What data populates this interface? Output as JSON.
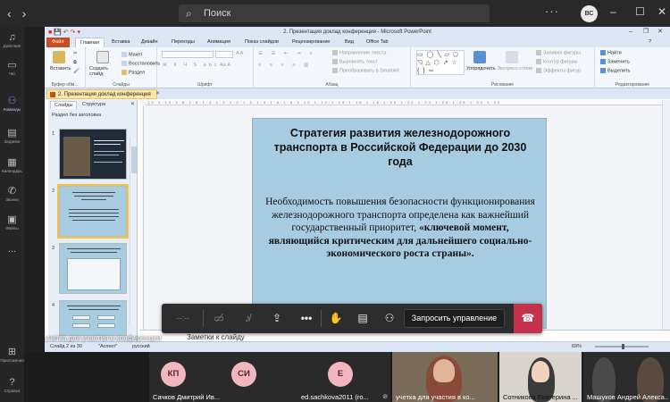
{
  "teams": {
    "search_placeholder": "Поиск",
    "user_initials": "ВС",
    "more_label": "···",
    "window_controls": [
      "–",
      "☐",
      "✕"
    ],
    "rail": [
      {
        "label": "Действия",
        "icon": "bell-icon"
      },
      {
        "label": "Чат",
        "icon": "chat-icon"
      },
      {
        "label": "Команды",
        "icon": "teams-icon",
        "active": true
      },
      {
        "label": "Задания",
        "icon": "assignments-icon"
      },
      {
        "label": "Календарь",
        "icon": "calendar-icon"
      },
      {
        "label": "Звонки",
        "icon": "phone-icon"
      },
      {
        "label": "Файлы",
        "icon": "files-icon"
      },
      {
        "label": "...",
        "icon": "more-icon"
      },
      {
        "label": "Приложения",
        "icon": "apps-icon"
      },
      {
        "label": "Справка",
        "icon": "help-icon"
      }
    ]
  },
  "ppt": {
    "window_title": "2. Презентация доклад конференция - Microsoft PowerPoint",
    "tabs": [
      "Файл",
      "Главная",
      "Вставка",
      "Дизайн",
      "Переходы",
      "Анимация",
      "Показ слайдов",
      "Рецензирование",
      "Вид",
      "Office Tab"
    ],
    "ribbon": {
      "paste": "Вставить",
      "clipboard_group": "Буфер обм...",
      "new_slide": "Создать слайд",
      "layout": "Макет",
      "reset": "Восстановить",
      "section": "Раздел",
      "slides_group": "Слайды",
      "font_group": "Шрифт",
      "paragraph_group": "Абзац",
      "text_direction": "Направление текста",
      "align_text": "Выровнять текст",
      "smartart": "Преобразовать в SmartArt",
      "arrange": "Упорядочить",
      "quick_styles": "Экспресс-стили",
      "shape_fill": "Заливка фигуры",
      "shape_outline": "Контур фигуры",
      "shape_effects": "Эффекты фигур",
      "drawing_group": "Рисование",
      "find": "Найти",
      "replace": "Заменить",
      "select": "Выделить",
      "editing_group": "Редактирование"
    },
    "doc_tab": "2. Презентация доклад конференция",
    "left_tabs": [
      "Слайды",
      "Структура"
    ],
    "section_label": "Раздел без заголовка",
    "thumb_numbers": [
      "1",
      "2",
      "3",
      "4"
    ],
    "slide": {
      "title": "Стратегия развития железнодорожного транспорта в Российской Федерации до 2030 года",
      "body_plain": "Необходимость повышения безопасности функционирования железнодорожного транспорта определена как важнейший государственный приоритет, ",
      "body_bold": "«ключевой момент, являющийся критическим для дальнейшего социально-экономического роста страны»."
    },
    "notes_label": "Заметки к слайду",
    "status": {
      "slide_counter": "Слайд 2 из 30",
      "theme": "\"Аспект\"",
      "language": "русский",
      "zoom": "69%"
    }
  },
  "call": {
    "timer": "--:--",
    "request_control": "Запросить управление"
  },
  "caption": "учетка для участия в конференции",
  "participants": [
    {
      "initials": "КП",
      "name": "Сачков Дмитрий Ив...",
      "type": "avatar"
    },
    {
      "initials": "СИ",
      "name": "",
      "type": "avatar"
    },
    {
      "initials": "Е",
      "name": "ed.sachkova2011 (го...",
      "type": "avatar"
    },
    {
      "initials": "",
      "name": "учетка для участия в ко...",
      "type": "video"
    },
    {
      "initials": "",
      "name": "Сотникова Екатерина ...",
      "type": "video"
    },
    {
      "initials": "",
      "name": "Машуков Андрей Алекса...",
      "type": "video"
    }
  ],
  "colors": {
    "slide_bg": "#a7cbe0",
    "file_tab": "#c94d23",
    "hangup": "#c4314b",
    "avatar_bg": "#f1b6bf",
    "teams_accent": "#8b8cf0"
  }
}
